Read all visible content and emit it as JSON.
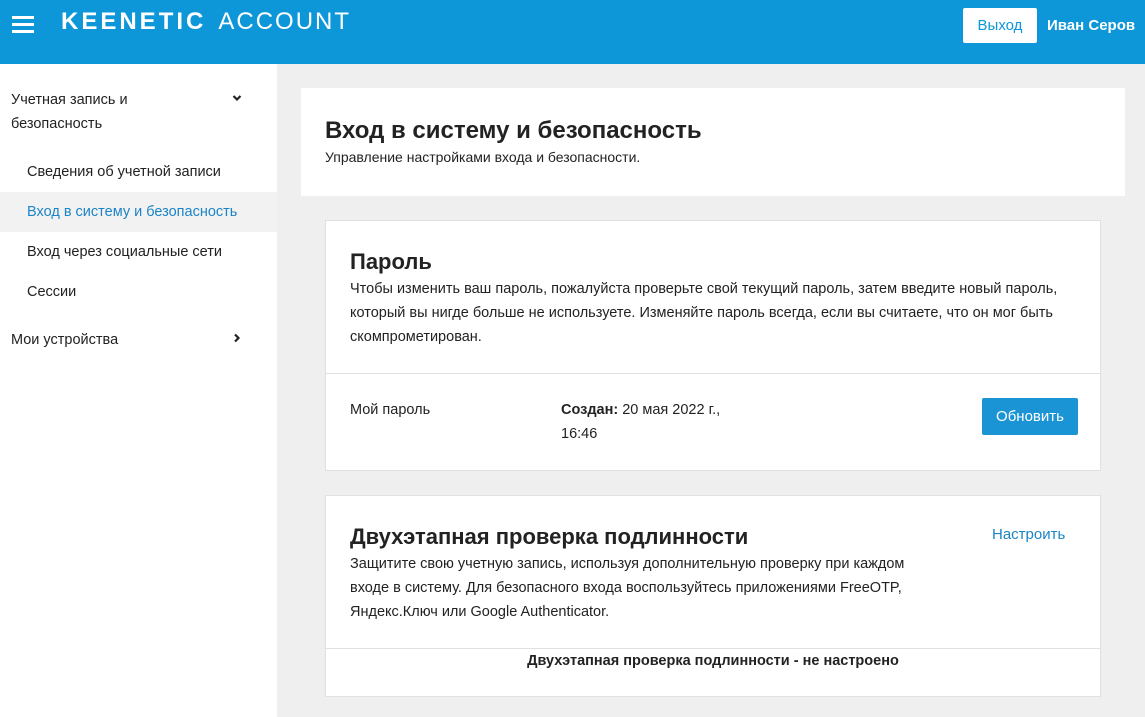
{
  "header": {
    "brand": "KEENETIC",
    "product": "ACCOUNT",
    "logout_label": "Выход",
    "user_name": "Иван Серов"
  },
  "sidebar": {
    "account_group_label": "Учетная запись и безопасность",
    "items": [
      {
        "label": "Сведения об учетной записи"
      },
      {
        "label": "Вход в систему и безопасность"
      },
      {
        "label": "Вход через социальные сети"
      },
      {
        "label": "Сессии"
      }
    ],
    "active_item": "Вход в систему и безопасность",
    "devices_group_label": "Мои устройства"
  },
  "page": {
    "title": "Вход в систему и безопасность",
    "subtitle": "Управление настройками входа и безопасности."
  },
  "password_card": {
    "title": "Пароль",
    "description": "Чтобы изменить ваш пароль, пожалуйста проверьте свой текущий пароль, затем введите новый пароль, который вы нигде больше не используете. Изменяйте пароль всегда, если вы считаете, что он мог быть скомпрометирован.",
    "row_label": "Мой пароль",
    "created_label": "Создан:",
    "created_value": "20 мая 2022 г., 16:46",
    "update_label": "Обновить"
  },
  "twofa_card": {
    "title": "Двухэтапная проверка подлинности",
    "description": "Защитите свою учетную запись, используя дополнительную проверку при каждом входе в систему. Для безопасного входа воспользуйтесь приложениями FreeOTP, Яндекс.Ключ или Google Authenticator.",
    "configure_label": "Настроить",
    "status": "Двухэтапная проверка подлинности - не настроено"
  },
  "colors": {
    "header_bg": "#0e97d8",
    "accent": "#1b94d6",
    "link": "#1b84c6"
  },
  "icons": [
    "menu-icon",
    "chevron-down-icon",
    "chevron-right-icon"
  ]
}
